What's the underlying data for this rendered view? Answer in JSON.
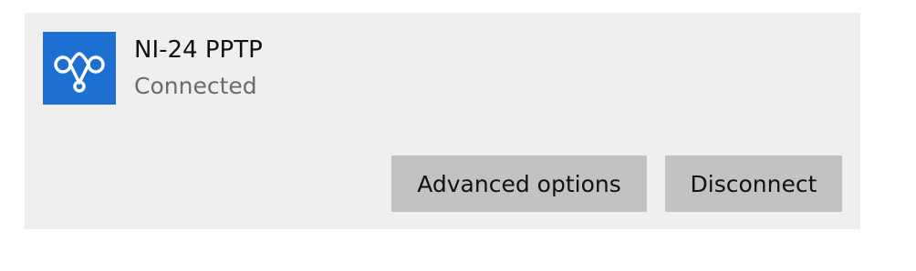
{
  "connection": {
    "name": "NI-24 PPTP",
    "status": "Connected"
  },
  "actions": {
    "advanced_options_label": "Advanced options",
    "disconnect_label": "Disconnect"
  },
  "icons": {
    "connection": "vpn-connection-icon"
  },
  "colors": {
    "icon_background": "#1e6fd2",
    "card_background": "#efefef",
    "button_background": "#c2c2c2",
    "status_text": "#6b6b6b"
  }
}
